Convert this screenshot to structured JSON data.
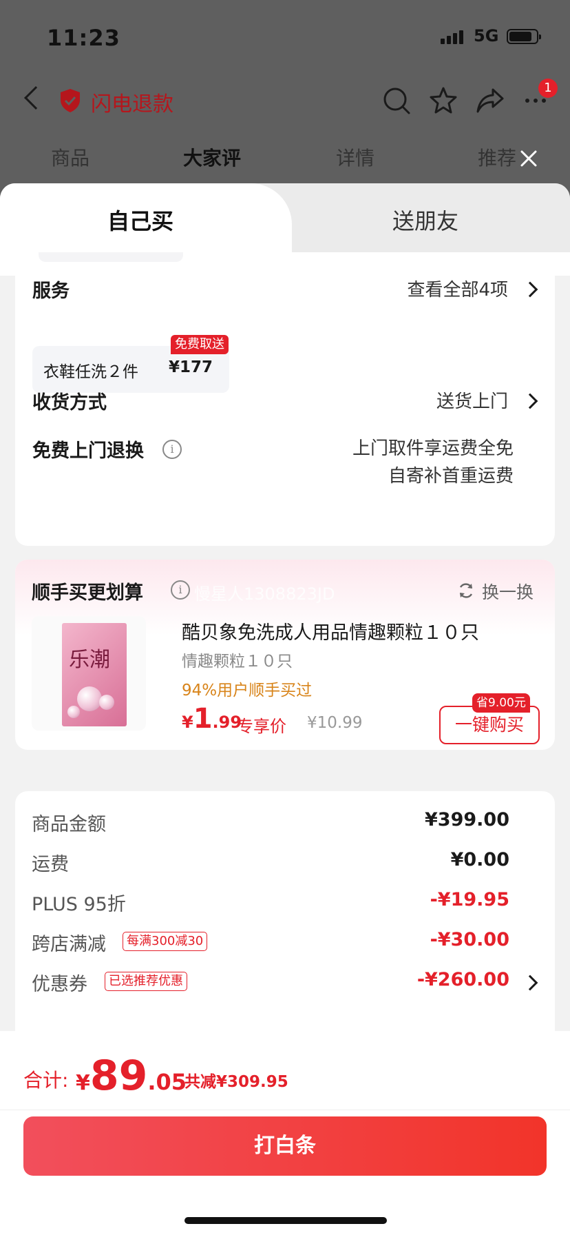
{
  "status_bar": {
    "time": "11:23",
    "network": "5G"
  },
  "navbar": {
    "title": "闪电退款",
    "badge": "1"
  },
  "page_tabs": [
    "商品",
    "大家评",
    "详情",
    "推荐"
  ],
  "sheet_tabs": {
    "self": "自己买",
    "friend": "送朋友"
  },
  "service": {
    "title": "服务",
    "view_all": "查看全部4项",
    "item_name": "衣鞋任洗２件",
    "item_price": "¥177",
    "item_tag": "免费取送"
  },
  "delivery": {
    "title": "收货方式",
    "value": "送货上门"
  },
  "return": {
    "title": "免费上门退换",
    "line1": "上门取件享运费全免",
    "line2": "自寄补首重运费"
  },
  "addon": {
    "title": "顺手买更划算",
    "watermark": "慢星人1308823JD",
    "refresh": "换一换",
    "product_title": "酷贝象免洗成人用品情趣颗粒１０只",
    "product_sub": "情趣颗粒１０只",
    "product_rate": "94%用户顺手买过",
    "price_currency": "¥",
    "price_int": "1",
    "price_dec": ".99",
    "price_label": "专享价",
    "orig_price": "¥10.99",
    "save_tag": "省9.00元",
    "buy_label": "一键购买",
    "box_text": "乐潮"
  },
  "fees": {
    "goods_label": "商品金额",
    "goods_value": "¥399.00",
    "ship_label": "运费",
    "ship_value": "¥0.00",
    "plus_label": "PLUS 95折",
    "plus_value": "-¥19.95",
    "cross_label": "跨店满减",
    "cross_tag": "每满300减30",
    "cross_value": "-¥30.00",
    "coupon_label": "优惠券",
    "coupon_tag": "已选推荐优惠",
    "coupon_value": "-¥260.00"
  },
  "footer": {
    "total_label": "合计:",
    "total_currency": "¥",
    "total_int": "89",
    "total_dec": ".05",
    "total_save": "共减¥309.95",
    "pay_label": "打白条"
  },
  "colors": {
    "accent": "#e4202a",
    "orange": "#d8841a"
  }
}
